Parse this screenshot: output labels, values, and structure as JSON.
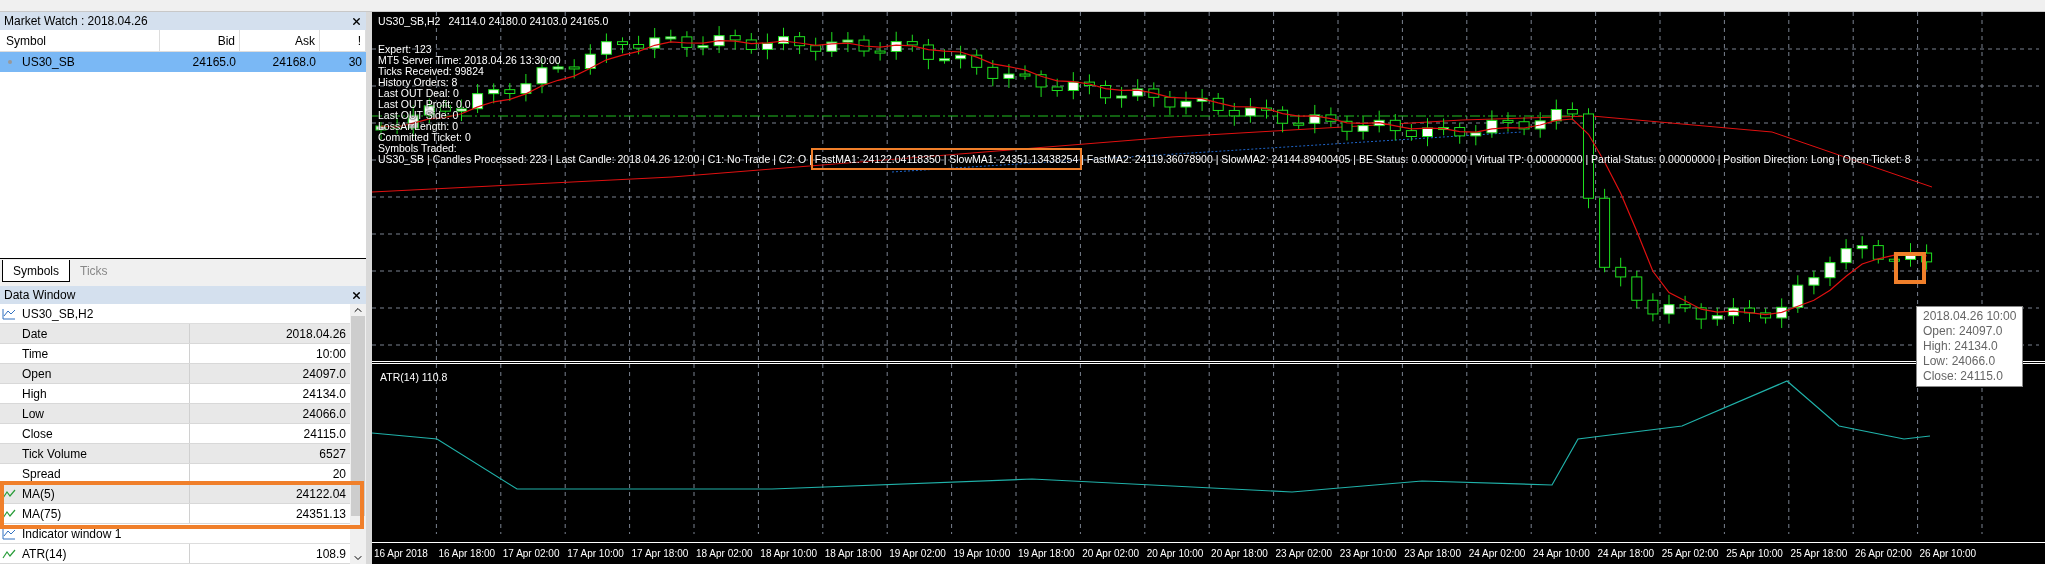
{
  "market_watch": {
    "title": "Market Watch : 2018.04.26",
    "columns": [
      "Symbol",
      "Bid",
      "Ask",
      "!"
    ],
    "rows": [
      {
        "symbol": "US30_SB",
        "bid": "24165.0",
        "ask": "24168.0",
        "spread": "30",
        "selected": true
      }
    ]
  },
  "tabs": [
    {
      "label": "Symbols",
      "selected": true
    },
    {
      "label": "Ticks",
      "selected": false
    }
  ],
  "data_window": {
    "title": "Data Window",
    "items": [
      {
        "kind": "series",
        "label": "US30_SB,H2"
      },
      {
        "kind": "field",
        "label": "Date",
        "value": "2018.04.26"
      },
      {
        "kind": "field",
        "label": "Time",
        "value": "10:00"
      },
      {
        "kind": "field",
        "label": "Open",
        "value": "24097.0"
      },
      {
        "kind": "field",
        "label": "High",
        "value": "24134.0"
      },
      {
        "kind": "field",
        "label": "Low",
        "value": "24066.0"
      },
      {
        "kind": "field",
        "label": "Close",
        "value": "24115.0"
      },
      {
        "kind": "field",
        "label": "Tick Volume",
        "value": "6527"
      },
      {
        "kind": "field",
        "label": "Spread",
        "value": "20"
      },
      {
        "kind": "indicator",
        "label": "MA(5)",
        "value": "24122.04"
      },
      {
        "kind": "indicator",
        "label": "MA(75)",
        "value": "24351.13"
      },
      {
        "kind": "series",
        "label": "Indicator window 1"
      },
      {
        "kind": "indicator",
        "label": "ATR(14)",
        "value": "108.9"
      }
    ]
  },
  "chart": {
    "symbol": "US30_SB,H2",
    "ohlc": "24114.0 24180.0 24103.0 24165.0",
    "expert_lines": [
      "Expert: 123",
      "MT5 Server Time: 2018.04.26 13:30:00",
      "Ticks Received: 99824",
      "History Orders: 8",
      "Last OUT Deal: 0",
      "Last OUT Profit: 0.0",
      "Last OUT Side: 0",
      "LossArrLength: 0",
      "Committed Ticket: 0",
      "Symbols Traded:"
    ],
    "status_line": "US30_SB | Candles Processed: 223 | Last Candle: 2018.04.26 12:00 | C1: No Trade | C2: O | FastMA1: 24122.04118350 | SlowMA1: 24351.13438254 | FastMA2: 24119.36078900 | SlowMA2: 24144.89400405 | BE Status: 0.00000000 | Virtual TP: 0.00000000 | Partial Status: 0.00000000 | Position Direction: Long | Open Ticket: 8",
    "subwindow_label": "ATR(14) 110.8",
    "tooltip": [
      "2018.04.26 10:00",
      "Open: 24097.0",
      "High: 24134.0",
      "Low: 24066.0",
      "Close: 24115.0"
    ],
    "time_axis": [
      "16 Apr 2018",
      "16 Apr 18:00",
      "17 Apr 02:00",
      "17 Apr 10:00",
      "17 Apr 18:00",
      "18 Apr 02:00",
      "18 Apr 10:00",
      "18 Apr 18:00",
      "19 Apr 02:00",
      "19 Apr 10:00",
      "19 Apr 18:00",
      "20 Apr 02:00",
      "20 Apr 10:00",
      "20 Apr 18:00",
      "23 Apr 02:00",
      "23 Apr 10:00",
      "23 Apr 18:00",
      "24 Apr 02:00",
      "24 Apr 10:00",
      "24 Apr 18:00",
      "25 Apr 02:00",
      "25 Apr 10:00",
      "25 Apr 18:00",
      "26 Apr 02:00",
      "26 Apr 10:00"
    ]
  }
}
